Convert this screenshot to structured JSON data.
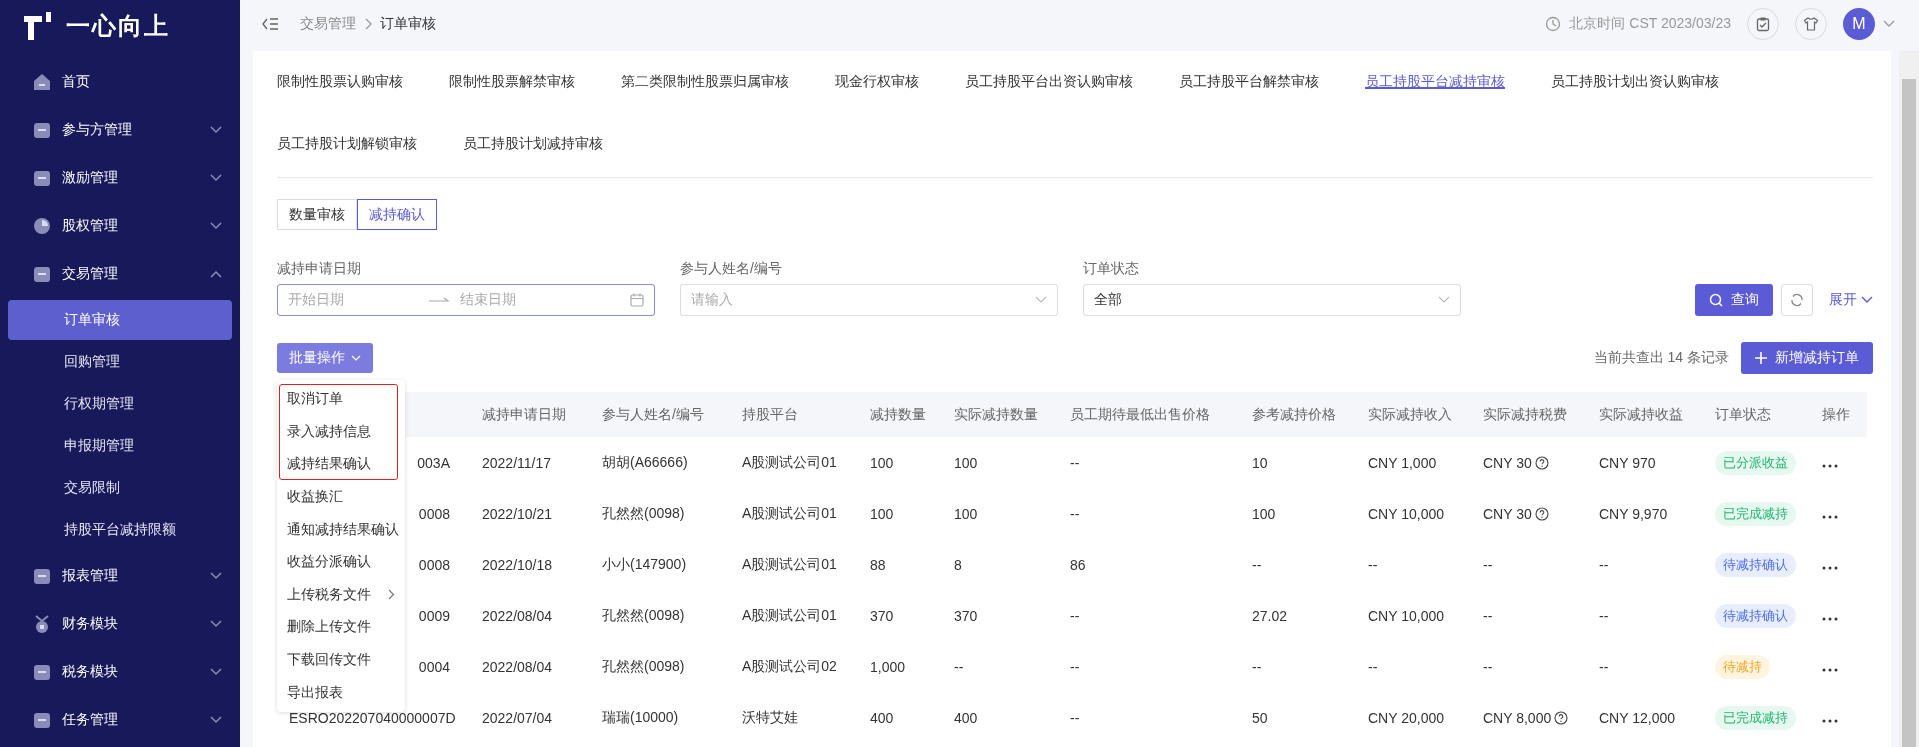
{
  "sidebar": {
    "logo": "一心向上",
    "items": [
      {
        "label": "首页"
      },
      {
        "label": "参与方管理",
        "expanded": false
      },
      {
        "label": "激励管理",
        "expanded": false
      },
      {
        "label": "股权管理",
        "expanded": false
      },
      {
        "label": "交易管理",
        "expanded": true,
        "children": [
          {
            "label": "订单审核",
            "selected": true
          },
          {
            "label": "回购管理",
            "selected": false
          },
          {
            "label": "行权期管理",
            "selected": false
          },
          {
            "label": "申报期管理",
            "selected": false
          },
          {
            "label": "交易限制",
            "selected": false
          },
          {
            "label": "持股平台减持限额",
            "selected": false
          }
        ]
      },
      {
        "label": "报表管理",
        "expanded": false
      },
      {
        "label": "财务模块",
        "expanded": false
      },
      {
        "label": "税务模块",
        "expanded": false
      },
      {
        "label": "任务管理",
        "expanded": false
      }
    ]
  },
  "header": {
    "breadcrumb": [
      "交易管理",
      "订单审核"
    ],
    "time": "北京时间 CST 2023/03/23",
    "avatar": "M"
  },
  "tabs": [
    {
      "label": "限制性股票认购审核",
      "selected": false
    },
    {
      "label": "限制性股票解禁审核",
      "selected": false
    },
    {
      "label": "第二类限制性股票归属审核",
      "selected": false
    },
    {
      "label": "现金行权审核",
      "selected": false
    },
    {
      "label": "员工持股平台出资认购审核",
      "selected": false
    },
    {
      "label": "员工持股平台解禁审核",
      "selected": false
    },
    {
      "label": "员工持股平台减持审核",
      "selected": true
    },
    {
      "label": "员工持股计划出资认购审核",
      "selected": false
    },
    {
      "label": "员工持股计划解锁审核",
      "selected": false
    },
    {
      "label": "员工持股计划减持审核",
      "selected": false
    }
  ],
  "segments": [
    {
      "label": "数量审核",
      "selected": false
    },
    {
      "label": "减持确认",
      "selected": true
    }
  ],
  "filters": {
    "date": {
      "label": "减持申请日期",
      "start_placeholder": "开始日期",
      "end_placeholder": "结束日期"
    },
    "participant": {
      "label": "参与人姓名/编号",
      "placeholder": "请输入"
    },
    "status": {
      "label": "订单状态",
      "value": "全部"
    },
    "search_button": "查询",
    "expand_link": "展开"
  },
  "batch_button": "批量操作",
  "batch_menu": [
    {
      "label": "取消订单",
      "highlighted": true
    },
    {
      "label": "录入减持信息",
      "highlighted": true
    },
    {
      "label": "减持结果确认",
      "highlighted": true
    },
    {
      "label": "收益换汇",
      "highlighted": false
    },
    {
      "label": "通知减持结果确认",
      "highlighted": false
    },
    {
      "label": "收益分派确认",
      "highlighted": false
    },
    {
      "label": "上传税务文件",
      "highlighted": false,
      "has_submenu": true
    },
    {
      "label": "删除上传文件",
      "highlighted": false
    },
    {
      "label": "下载回传文件",
      "highlighted": false
    },
    {
      "label": "导出报表",
      "highlighted": false
    }
  ],
  "record_count": "当前共查出 14 条记录",
  "add_button": "新增减持订单",
  "table": {
    "columns": [
      "减持申请日期",
      "参与人姓名/编号",
      "持股平台",
      "减持数量",
      "实际减持数量",
      "员工期待最低出售价格",
      "参考减持价格",
      "实际减持收入",
      "实际减持税费",
      "实际减持收益",
      "订单状态",
      "操作"
    ],
    "rows": [
      {
        "column_1": "003A",
        "date": "2022/11/17",
        "participant": "胡胡(A66666)",
        "platform": "A股测试公司01",
        "qty": "100",
        "actual_qty": "100",
        "min_price": "--",
        "ref_price": "10",
        "income": "CNY 1,000",
        "tax": "CNY 30",
        "tax_info": true,
        "proceeds": "CNY 970",
        "status": {
          "text": "已分派收益",
          "kind": "done"
        }
      },
      {
        "column_1": "0008",
        "date": "2022/10/21",
        "participant": "孔然然(0098)",
        "platform": "A股测试公司01",
        "qty": "100",
        "actual_qty": "100",
        "min_price": "--",
        "ref_price": "100",
        "income": "CNY 10,000",
        "tax": "CNY 30",
        "tax_info": true,
        "proceeds": "CNY 9,970",
        "status": {
          "text": "已完成减持",
          "kind": "done"
        }
      },
      {
        "column_1": "0008",
        "date": "2022/10/18",
        "participant": "小小(147900)",
        "platform": "A股测试公司01",
        "qty": "88",
        "actual_qty": "8",
        "min_price": "86",
        "ref_price": "--",
        "income": "--",
        "tax": "--",
        "tax_info": false,
        "proceeds": "--",
        "status": {
          "text": "待减持确认",
          "kind": "confirm"
        }
      },
      {
        "column_1": "0009",
        "date": "2022/08/04",
        "participant": "孔然然(0098)",
        "platform": "A股测试公司01",
        "qty": "370",
        "actual_qty": "370",
        "min_price": "--",
        "ref_price": "27.02",
        "income": "CNY 10,000",
        "tax": "--",
        "tax_info": false,
        "proceeds": "--",
        "status": {
          "text": "待减持确认",
          "kind": "confirm"
        }
      },
      {
        "column_1": "0004",
        "date": "2022/08/04",
        "participant": "孔然然(0098)",
        "platform": "A股测试公司02",
        "qty": "1,000",
        "actual_qty": "--",
        "min_price": "--",
        "ref_price": "--",
        "income": "--",
        "tax": "--",
        "tax_info": false,
        "proceeds": "--",
        "status": {
          "text": "待减持",
          "kind": "pending"
        }
      },
      {
        "column_1": "ESRO202207040000007D",
        "date": "2022/07/04",
        "participant": "瑞瑞(10000)",
        "platform": "沃特艾娃",
        "qty": "400",
        "actual_qty": "400",
        "min_price": "--",
        "ref_price": "50",
        "income": "CNY 20,000",
        "tax": "CNY 8,000",
        "tax_info": true,
        "proceeds": "CNY 12,000",
        "status": {
          "text": "已完成减持",
          "kind": "done"
        }
      }
    ]
  }
}
